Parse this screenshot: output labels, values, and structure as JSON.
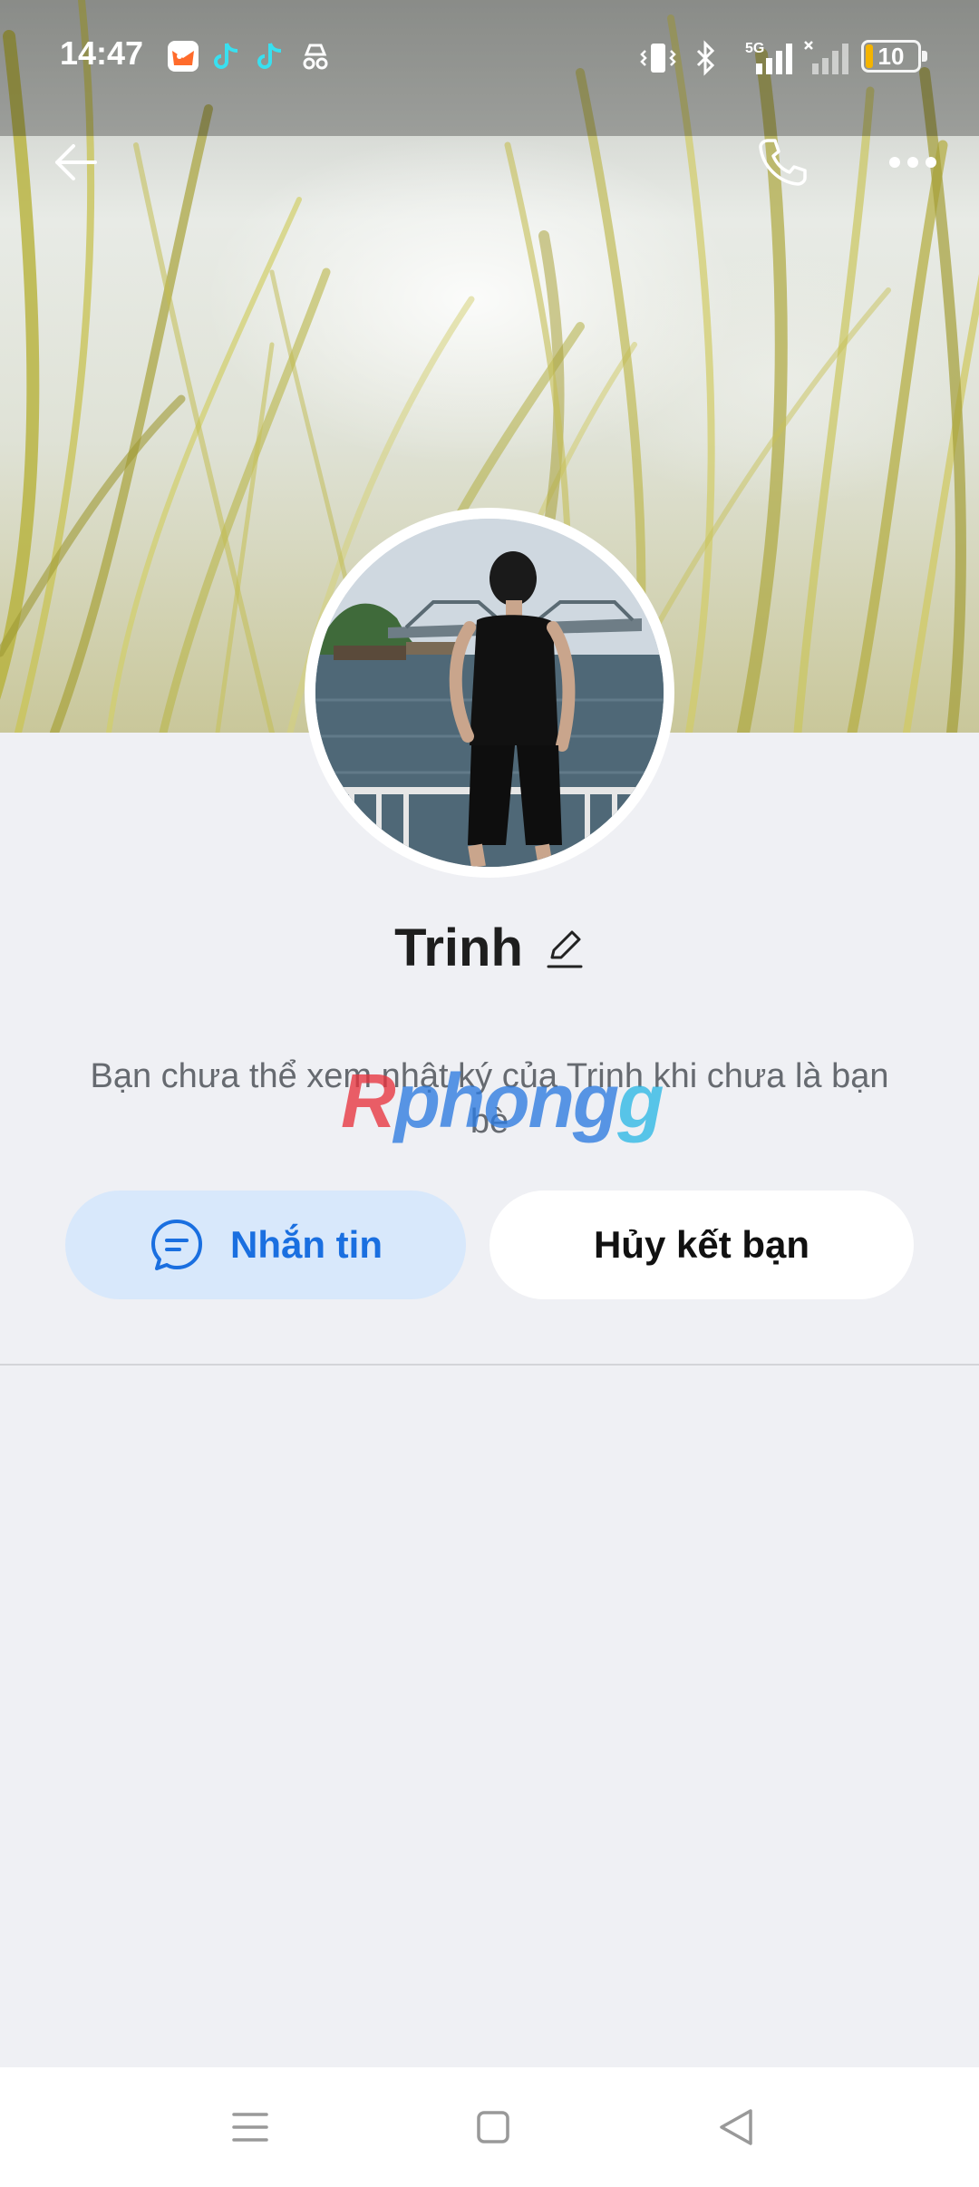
{
  "status_bar": {
    "time": "14:47",
    "battery": "10",
    "network": "5G",
    "icons": [
      "game-app-icon",
      "tiktok-icon",
      "tiktok-icon",
      "incognito-icon",
      "vibrate-icon",
      "bluetooth-icon",
      "signal-icon",
      "signal-no-service-icon",
      "battery-icon"
    ]
  },
  "header": {
    "back_icon": "arrow-left-icon",
    "call_icon": "phone-icon",
    "more_icon": "more-dots-icon"
  },
  "profile": {
    "name": "Trinh",
    "edit_icon": "pencil-icon",
    "notice": "Bạn chưa thể xem nhật ký của Trinh khi chưa là bạn bè"
  },
  "watermark": {
    "part1": "R",
    "part2": "phong",
    "part3": "g"
  },
  "actions": {
    "message_label": "Nhắn tin",
    "unfriend_label": "Hủy kết bạn"
  },
  "colors": {
    "accent": "#1a6fe0",
    "message_bg": "#d8e8fb",
    "page_bg": "#eff0f4"
  },
  "system_nav": {
    "icons": [
      "menu-icon",
      "home-icon",
      "back-triangle-icon"
    ]
  }
}
